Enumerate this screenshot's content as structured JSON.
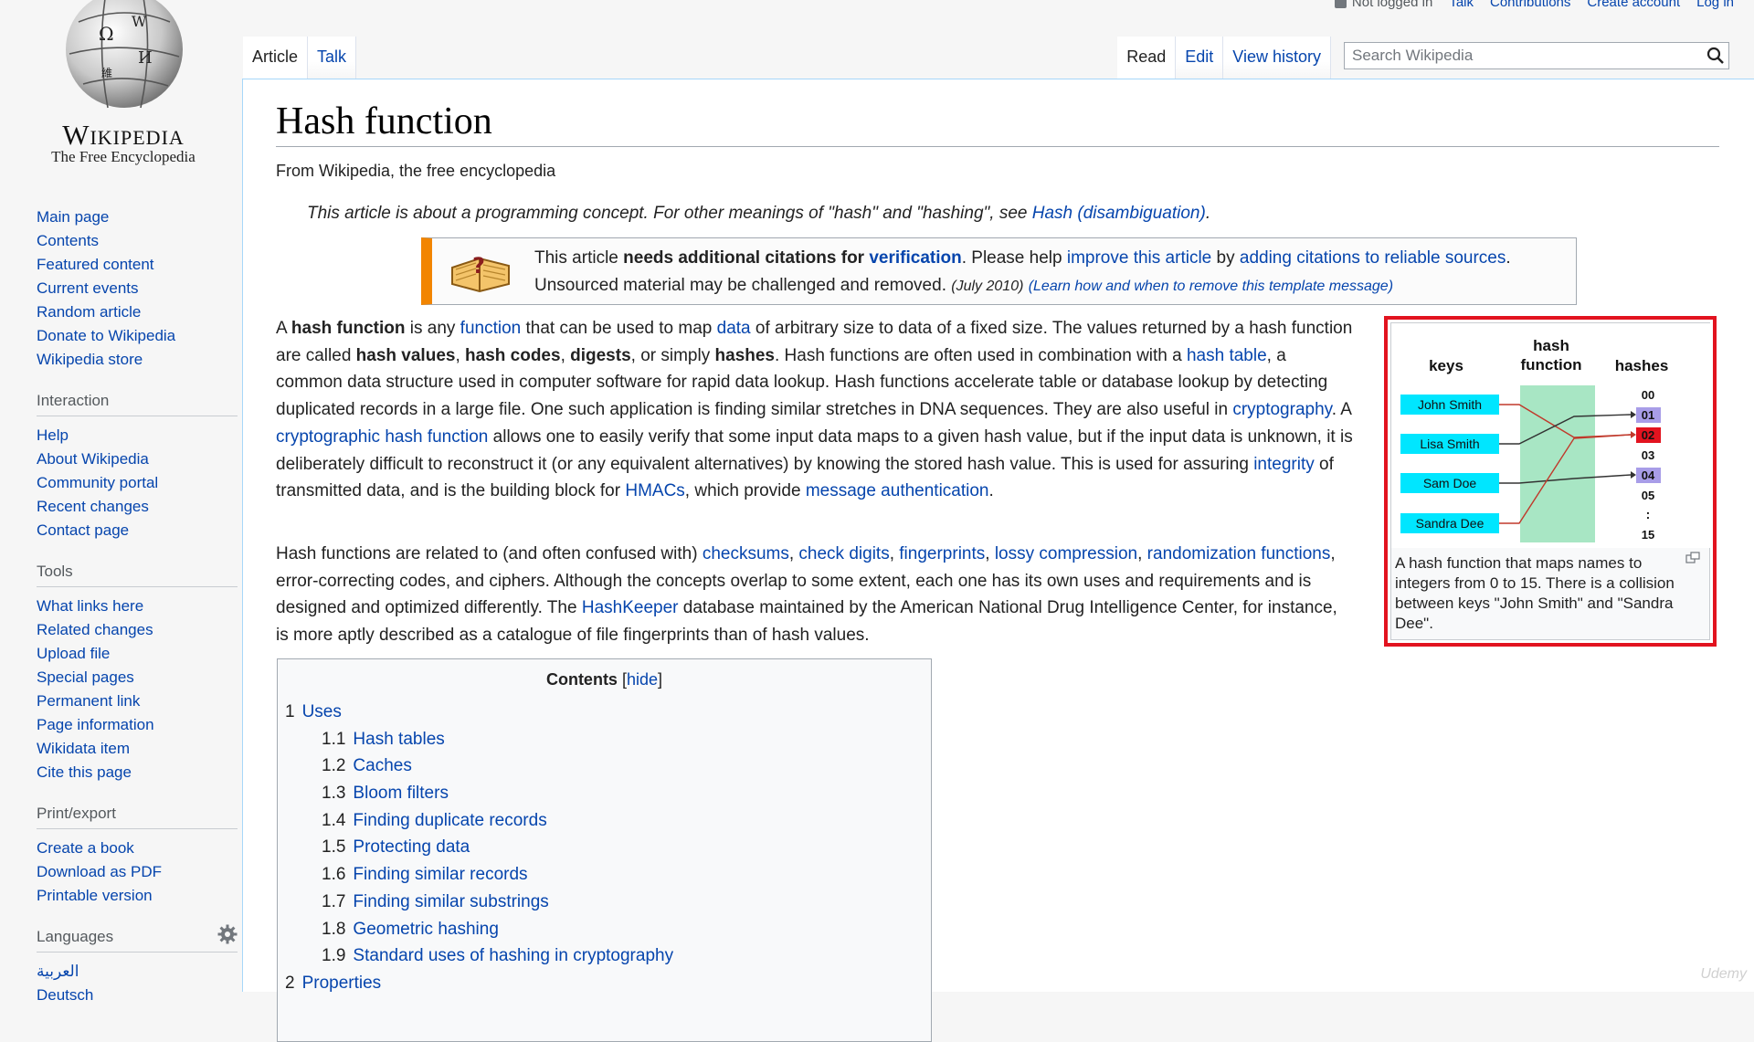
{
  "personal_tools": {
    "not_logged_in": "Not logged in",
    "talk": "Talk",
    "contributions": "Contributions",
    "create_account": "Create account",
    "log_in": "Log in"
  },
  "logo": {
    "wordmark": "Wikipedia",
    "tagline": "The Free Encyclopedia",
    "globe_icon": "puzzle-globe-icon"
  },
  "sidebar": {
    "navigation": [
      "Main page",
      "Contents",
      "Featured content",
      "Current events",
      "Random article",
      "Donate to Wikipedia",
      "Wikipedia store"
    ],
    "interaction_heading": "Interaction",
    "interaction": [
      "Help",
      "About Wikipedia",
      "Community portal",
      "Recent changes",
      "Contact page"
    ],
    "tools_heading": "Tools",
    "tools": [
      "What links here",
      "Related changes",
      "Upload file",
      "Special pages",
      "Permanent link",
      "Page information",
      "Wikidata item",
      "Cite this page"
    ],
    "print_heading": "Print/export",
    "print": [
      "Create a book",
      "Download as PDF",
      "Printable version"
    ],
    "languages_heading": "Languages",
    "languages": [
      "العربية",
      "Deutsch"
    ]
  },
  "tabs": {
    "article": "Article",
    "talk": "Talk",
    "read": "Read",
    "edit": "Edit",
    "view_history": "View history"
  },
  "search": {
    "placeholder": "Search Wikipedia"
  },
  "article": {
    "title": "Hash function",
    "from": "From Wikipedia, the free encyclopedia",
    "hatnote_prefix": "This article is about a programming concept. For other meanings of \"hash\" and \"hashing\", see ",
    "hatnote_link": "Hash (disambiguation)",
    "hatnote_suffix": ".",
    "ambox": {
      "t1": "This article ",
      "t2_bold": "needs additional citations for ",
      "t3_link": "verification",
      "t4": ". Please help ",
      "t5_link": "improve this article",
      "t6": " by ",
      "t7_link": "adding citations to reliable sources",
      "t8": ". Unsourced material may be challenged and removed. ",
      "date": "(July 2010)",
      "learn_link": "(Learn how and when to remove this template message)"
    },
    "p1": {
      "s1": "A ",
      "b1": "hash function",
      "s2": " is any ",
      "l1": "function",
      "s3": " that can be used to map ",
      "l2": "data",
      "s4": " of arbitrary size to data of a fixed size. The values returned by a hash function are called ",
      "b2": "hash values",
      "s5": ", ",
      "b3": "hash codes",
      "s6": ", ",
      "b4": "digests",
      "s7": ", or simply ",
      "b5": "hashes",
      "s8": ". Hash functions are often used in combination with a ",
      "l3": "hash table",
      "s9": ", a common data structure used in computer software for rapid data lookup. Hash functions accelerate table or database lookup by detecting duplicated records in a large file. One such application is finding similar stretches in DNA sequences. They are also useful in ",
      "l4": "cryptography",
      "s10": ". A ",
      "l5": "cryptographic hash function",
      "s11": " allows one to easily verify that some input data maps to a given hash value, but if the input data is unknown, it is deliberately difficult to reconstruct it (or any equivalent alternatives) by knowing the stored hash value. This is used for assuring ",
      "l6": "integrity",
      "s12": " of transmitted data, and is the building block for ",
      "l7": "HMACs",
      "s13": ", which provide ",
      "l8": "message authentication",
      "s14": "."
    },
    "p2": {
      "s1": "Hash functions are related to (and often confused with) ",
      "l1": "checksums",
      "s2": ", ",
      "l2": "check digits",
      "s3": ", ",
      "l3": "fingerprints",
      "s4": ", ",
      "l4": "lossy compression",
      "s5": ", ",
      "l5": "randomization functions",
      "s6": ", error-correcting codes, and ciphers. Although the concepts overlap to some extent, each one has its own uses and requirements and is designed and optimized differently. The ",
      "l6": "HashKeeper",
      "s7": " database maintained by the American National Drug Intelligence Center, for instance, is more aptly described as a catalogue of file fingerprints than of hash values."
    }
  },
  "figure": {
    "head_keys": "keys",
    "head_hash_1": "hash",
    "head_hash_2": "function",
    "head_hashes": "hashes",
    "keys": [
      "John Smith",
      "Lisa Smith",
      "Sam Doe",
      "Sandra Dee"
    ],
    "hashes": [
      "00",
      "01",
      "02",
      "03",
      "04",
      "05",
      ":",
      "15"
    ],
    "caption": "A hash function that maps names to integers from 0 to 15. There is a collision between keys \"John Smith\" and \"Sandra Dee\".",
    "colors": {
      "frame": "#e2131f",
      "key_fill": "#00e6ff",
      "function_fill": "#a8e6c4",
      "collision": "#e2131f",
      "used_hash": "#a89de8"
    }
  },
  "toc": {
    "title": "Contents",
    "hide": "hide",
    "items": [
      {
        "num": "1",
        "label": "Uses",
        "level": 1
      },
      {
        "num": "1.1",
        "label": "Hash tables",
        "level": 2
      },
      {
        "num": "1.2",
        "label": "Caches",
        "level": 2
      },
      {
        "num": "1.3",
        "label": "Bloom filters",
        "level": 2
      },
      {
        "num": "1.4",
        "label": "Finding duplicate records",
        "level": 2
      },
      {
        "num": "1.5",
        "label": "Protecting data",
        "level": 2
      },
      {
        "num": "1.6",
        "label": "Finding similar records",
        "level": 2
      },
      {
        "num": "1.7",
        "label": "Finding similar substrings",
        "level": 2
      },
      {
        "num": "1.8",
        "label": "Geometric hashing",
        "level": 2
      },
      {
        "num": "1.9",
        "label": "Standard uses of hashing in cryptography",
        "level": 2
      },
      {
        "num": "2",
        "label": "Properties",
        "level": 1
      }
    ]
  },
  "watermark": "Udemy"
}
